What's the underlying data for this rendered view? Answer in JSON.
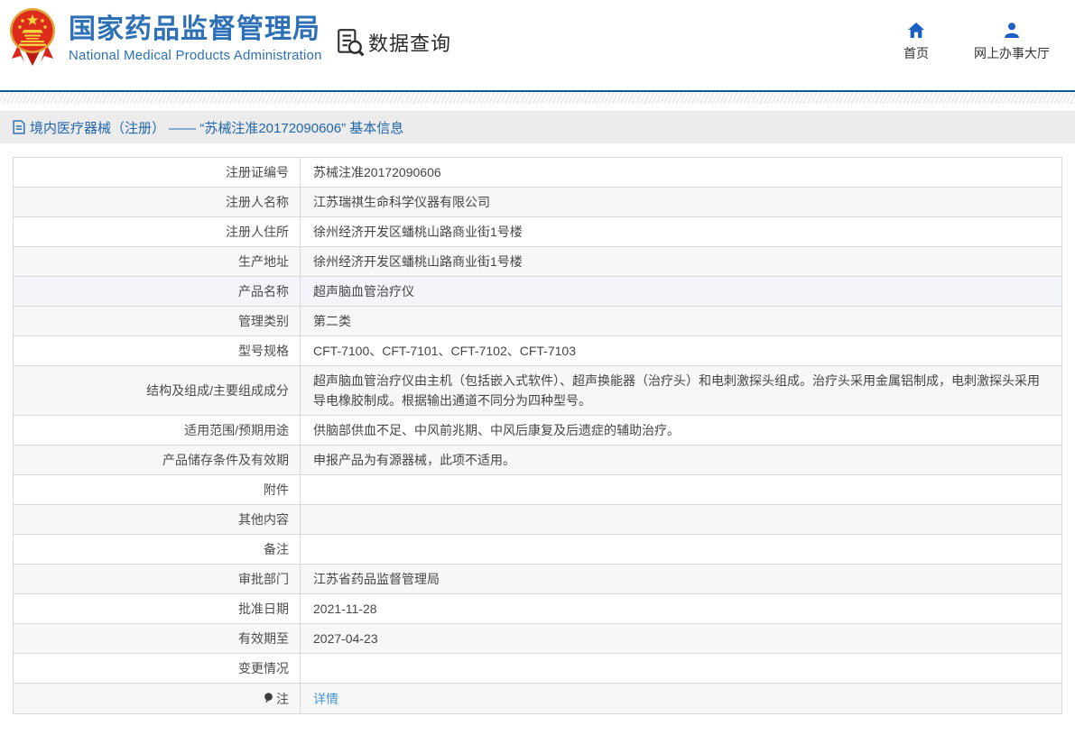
{
  "header": {
    "org_name": "国家药品监督管理局",
    "org_name_en": "National Medical Products Administration",
    "datasearch_label": "数据查询",
    "nav": {
      "home": {
        "label": "首页"
      },
      "hall": {
        "label": "网上办事大厅"
      }
    }
  },
  "breadcrumb": {
    "text": "境内医疗器械（注册） —— “苏械注准20172090606” 基本信息"
  },
  "table": {
    "rows": [
      {
        "label": "注册证编号",
        "value": "苏械注准20172090606",
        "bg": "white"
      },
      {
        "label": "注册人名称",
        "value": "江苏瑞祺生命科学仪器有限公司",
        "bg": "gray"
      },
      {
        "label": "注册人住所",
        "value": "徐州经济开发区蟠桃山路商业街1号楼",
        "bg": "white"
      },
      {
        "label": "生产地址",
        "value": "徐州经济开发区蟠桃山路商业街1号楼",
        "bg": "gray"
      },
      {
        "label": "产品名称",
        "value": "超声脑血管治疗仪",
        "bg": "hover"
      },
      {
        "label": "管理类别",
        "value": "第二类",
        "bg": "gray"
      },
      {
        "label": "型号规格",
        "value": "CFT-7100、CFT-7101、CFT-7102、CFT-7103",
        "bg": "white"
      },
      {
        "label": "结构及组成/主要组成成分",
        "value": "超声脑血管治疗仪由主机（包括嵌入式软件）、超声换能器（治疗头）和电刺激探头组成。治疗头采用金属铝制成，电刺激探头采用导电橡胶制成。根据输出通道不同分为四种型号。",
        "bg": "gray"
      },
      {
        "label": "适用范围/预期用途",
        "value": "供脑部供血不足、中风前兆期、中风后康复及后遗症的辅助治疗。",
        "bg": "white"
      },
      {
        "label": "产品储存条件及有效期",
        "value": "申报产品为有源器械，此项不适用。",
        "bg": "gray"
      },
      {
        "label": "附件",
        "value": "",
        "bg": "white"
      },
      {
        "label": "其他内容",
        "value": "",
        "bg": "gray"
      },
      {
        "label": "备注",
        "value": "",
        "bg": "white"
      },
      {
        "label": "审批部门",
        "value": "江苏省药品监督管理局",
        "bg": "gray"
      },
      {
        "label": "批准日期",
        "value": "2021-11-28",
        "bg": "white"
      },
      {
        "label": "有效期至",
        "value": "2027-04-23",
        "bg": "gray"
      },
      {
        "label": "变更情况",
        "value": "",
        "bg": "white"
      },
      {
        "label": "注",
        "value": "详情",
        "bg": "gray",
        "note_icon": true,
        "link": true
      }
    ]
  },
  "colors": {
    "title_blue": "#2d70b5",
    "icon_blue": "#1b5ec6",
    "header_line_blue": "#0d5ba7",
    "breadcrumb_bg": "#ececec",
    "breadcrumb_text": "#2066ad",
    "row_gray": "#f7f7f7",
    "row_hover": "#f3f5fa",
    "table_border": "#d9d9d9",
    "link_blue": "#4693d8"
  }
}
